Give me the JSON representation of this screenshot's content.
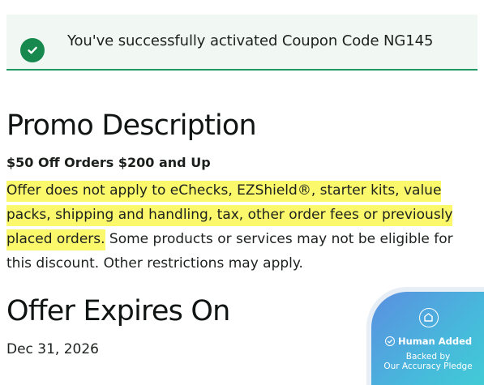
{
  "alert": {
    "icon": "check-circle-icon",
    "message": "You've successfully activated Coupon Code NG145",
    "accent": "#17894f"
  },
  "promo": {
    "title": "Promo Description",
    "subtitle": "$50 Off Orders $200 and Up",
    "highlighted_text": "Offer does not apply to eChecks, EZShield®, starter kits, value packs, shipping and handling, tax, other order fees or previously placed orders.",
    "rest_text": " Some products or services may not be eligible for this discount. Other restrictions may apply.",
    "highlight_color": "#fbf86c"
  },
  "expires": {
    "title": "Offer Expires On",
    "date": "Dec 31, 2026"
  },
  "badge": {
    "icon": "house-logo-icon",
    "check_icon": "check-circle-icon",
    "title": "Human Added",
    "line1": "Backed by",
    "line2": "Our Accuracy Pledge"
  }
}
